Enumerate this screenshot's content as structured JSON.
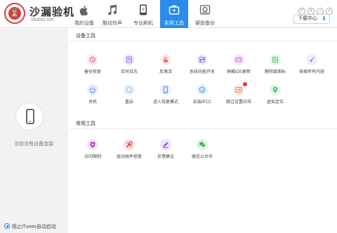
{
  "app": {
    "name": "沙漏验机",
    "domain": "shalou.net"
  },
  "nav_tabs": [
    {
      "label": "我的设备",
      "icon": "apple-icon",
      "active": false
    },
    {
      "label": "酷炫铃声",
      "icon": "music-note-icon",
      "active": false
    },
    {
      "label": "专业刷机",
      "icon": "flash-phone-icon",
      "active": false
    },
    {
      "label": "实用工具",
      "icon": "toolbox-icon",
      "active": true
    },
    {
      "label": "硬盘备份",
      "icon": "disk-backup-icon",
      "active": false
    }
  ],
  "header": {
    "download_center": "下载中心"
  },
  "left_panel": {
    "no_device_text": "当前没有设备连接",
    "itunes_option": "阻止iTunes自动启动"
  },
  "sections": {
    "device_tools": "设备工具",
    "common_tools": "常用工具"
  },
  "device_tools": [
    {
      "label": "备份恢复",
      "icon": "backup-restore-icon",
      "color": "#e86aa0"
    },
    {
      "label": "实时日志",
      "icon": "realtime-log-icon",
      "color": "#9c6fe0"
    },
    {
      "label": "反激活",
      "icon": "unlock-icon",
      "color": "#e8707a"
    },
    {
      "label": "系统功能开关",
      "icon": "toggle-switches-icon",
      "color": "#9b7fe6"
    },
    {
      "label": "屏蔽iOS更新",
      "icon": "block-update-icon",
      "color": "#c46ee0"
    },
    {
      "label": "删除废图标",
      "icon": "delete-icons-icon",
      "color": "#5cc27a"
    },
    {
      "label": "抹掉所有内容",
      "icon": "erase-broom-icon",
      "color": "#8a8ee0"
    },
    {
      "label": "关机",
      "icon": "power-icon",
      "color": "#5b8ee8"
    },
    {
      "label": "重启",
      "icon": "restart-icon",
      "color": "#5b9ee8"
    },
    {
      "label": "进入恢复模式",
      "icon": "recovery-phone-icon",
      "color": "#5b8ee8"
    },
    {
      "label": "安装IPCC",
      "icon": "ipcc-install-icon",
      "color": "#5aa0e0"
    },
    {
      "label": "跳过设置向导",
      "icon": "skip-wizard-icon",
      "color": "#e8844a",
      "badge": true
    },
    {
      "label": "虚拟定位",
      "icon": "location-pin-icon",
      "color": "#4cba7a"
    }
  ],
  "common_tools": [
    {
      "label": "访问限制",
      "icon": "restriction-shield-icon",
      "color": "#c246d6"
    },
    {
      "label": "驱动插件修复",
      "icon": "driver-repair-icon",
      "color": "#e03a3a"
    },
    {
      "label": "反馈建议",
      "icon": "feedback-pen-icon",
      "color": "#8a4ad6"
    },
    {
      "label": "微信公众号",
      "icon": "wechat-icon",
      "color": "#3fb34f"
    }
  ],
  "colors": {
    "accent": "#2a8be8",
    "brand": "#e03a3a"
  }
}
